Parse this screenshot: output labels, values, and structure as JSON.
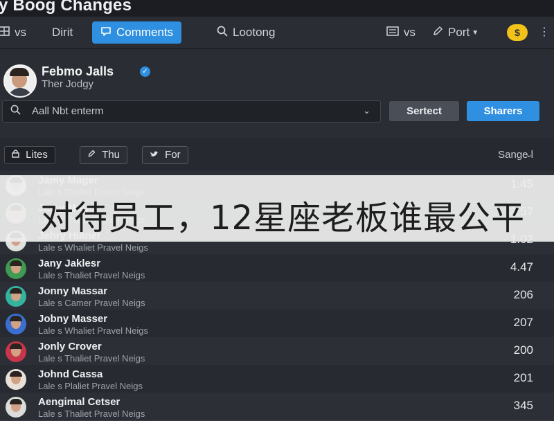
{
  "app": {
    "title": "y Boog Changes"
  },
  "toolbar": {
    "items": [
      {
        "icon": "grid-icon",
        "label": "vs"
      },
      {
        "label": "Dirit"
      },
      {
        "icon": "comment-icon",
        "label": "Comments",
        "active": true
      },
      {
        "icon": "search-icon",
        "label": "Lootong"
      },
      {
        "icon": "list-icon",
        "label": "vs"
      },
      {
        "icon": "pencil-icon",
        "label": "Port"
      }
    ],
    "coin_label": "$",
    "menu_label": "⋮"
  },
  "profile": {
    "name": "Febmo Jalls",
    "subtitle": "Ther Jodgy",
    "verified": true
  },
  "search": {
    "placeholder": "Aall Nbt enterm",
    "select_label": "Sertect",
    "share_label": "Sharers"
  },
  "filters": {
    "chips": [
      {
        "icon": "lock-icon",
        "label": "Lites",
        "active": true
      },
      {
        "icon": "pencil-icon",
        "label": "Thu"
      },
      {
        "icon": "bird-icon",
        "label": "For"
      }
    ],
    "sort_label": "Sange l"
  },
  "list": {
    "rows": [
      {
        "name": "Jamy Mager",
        "subtitle": "Lale s Thaliet Pravel Neigs",
        "value": "1.45",
        "avatar_color": "#d9d9d9"
      },
      {
        "name": "Jamy Mager",
        "subtitle": "Lale s Thaliet Pravel Neigs",
        "value": "3.57",
        "avatar_color": "#d6c4b0"
      },
      {
        "name": "Jehry Hianer",
        "subtitle": "Lale s Whaliet Pravel Neigs",
        "value": "1.02",
        "avatar_color": "#e0e0e0"
      },
      {
        "name": "Jany Jaklesr",
        "subtitle": "Lale s Thaliet Pravel Neigs",
        "value": "4.47",
        "avatar_color": "#3f9a53"
      },
      {
        "name": "Jonny Massar",
        "subtitle": "Lale s Camer Pravel Neigs",
        "value": "206",
        "avatar_color": "#33b3a0"
      },
      {
        "name": "Jobny Masser",
        "subtitle": "Lale s Whaliet Pravel Neigs",
        "value": "207",
        "avatar_color": "#3a6fd1"
      },
      {
        "name": "Jonly Crover",
        "subtitle": "Lale s Thaliet Pravel Neigs",
        "value": "200",
        "avatar_color": "#c9364b"
      },
      {
        "name": "Johnd Cassa",
        "subtitle": "Lale s Plaliet Pravel Neigs",
        "value": "201",
        "avatar_color": "#e7e1d8"
      },
      {
        "name": "Aengimal Cetser",
        "subtitle": "Lale s Thaliet Pravel Neigs",
        "value": "345",
        "avatar_color": "#dcdcdc"
      }
    ]
  },
  "overlay": {
    "text": "对待员工，12星座老板谁最公平"
  },
  "colors": {
    "accent": "#2f8fe0",
    "background": "#20232b",
    "coin": "#f2c21a"
  }
}
